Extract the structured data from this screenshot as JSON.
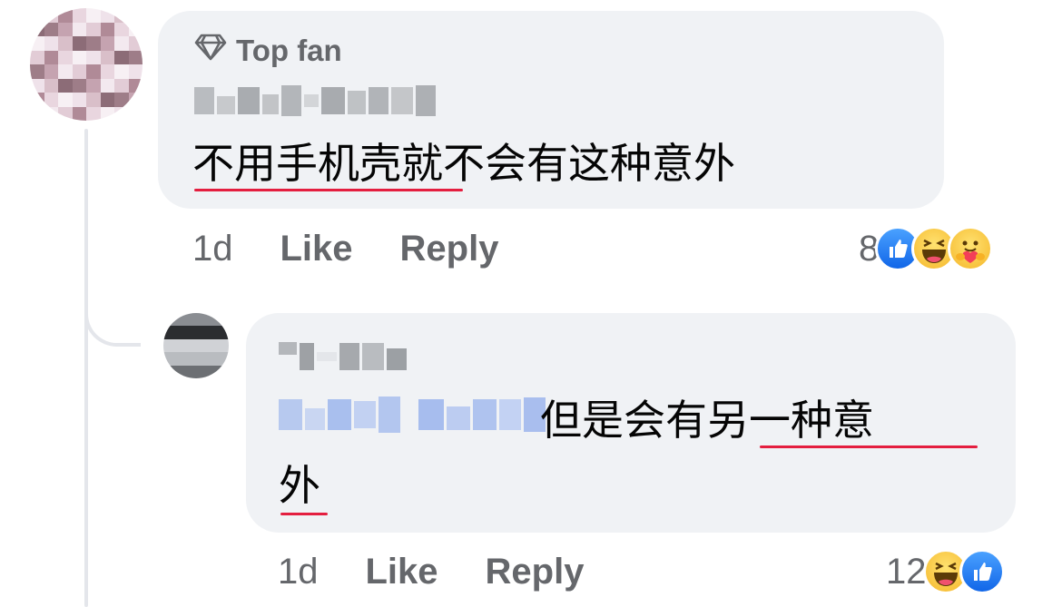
{
  "comment": {
    "badge": "Top fan",
    "text": "不用手机壳就不会有这种意外",
    "time": "1d",
    "like_label": "Like",
    "reply_label": "Reply",
    "reaction_count": "8",
    "reactions": [
      "like-icon",
      "haha-icon",
      "care-icon"
    ]
  },
  "reply": {
    "text_line1": "但是会有另一种意",
    "text_line2": "外",
    "time": "1d",
    "like_label": "Like",
    "reply_label": "Reply",
    "reaction_count": "12",
    "reactions": [
      "haha-icon",
      "like-icon"
    ]
  },
  "colors": {
    "bubble": "#f0f2f5",
    "secondary_text": "#65676b",
    "underline": "#e41e3f",
    "like_blue": "#1877f2"
  }
}
